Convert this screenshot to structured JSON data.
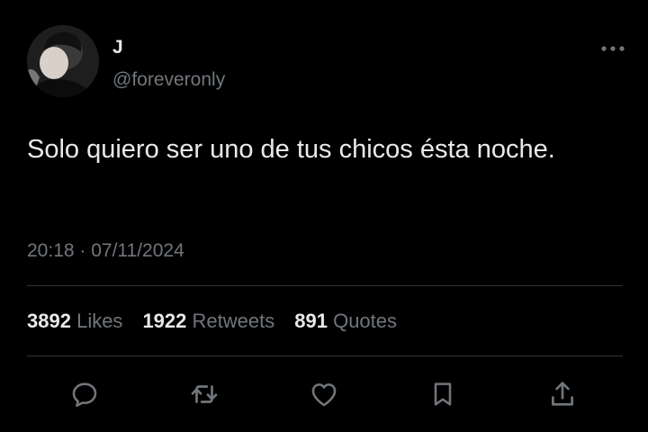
{
  "author": {
    "display_name": "J",
    "handle": "@foreveronly"
  },
  "tweet": {
    "text": "Solo quiero ser uno de tus chicos ésta noche.",
    "timestamp": "20:18 · 07/11/2024"
  },
  "stats": [
    {
      "count": "3892",
      "label": "Likes"
    },
    {
      "count": "1922",
      "label": "Retweets"
    },
    {
      "count": "891",
      "label": "Quotes"
    }
  ],
  "actions": [
    {
      "icon": "reply-icon"
    },
    {
      "icon": "retweet-icon"
    },
    {
      "icon": "heart-icon"
    },
    {
      "icon": "bookmark-icon"
    },
    {
      "icon": "share-icon"
    }
  ],
  "colors": {
    "background": "#000000",
    "primary_text": "#e7e9ea",
    "secondary_text": "#71767b",
    "divider": "#2f3336"
  }
}
